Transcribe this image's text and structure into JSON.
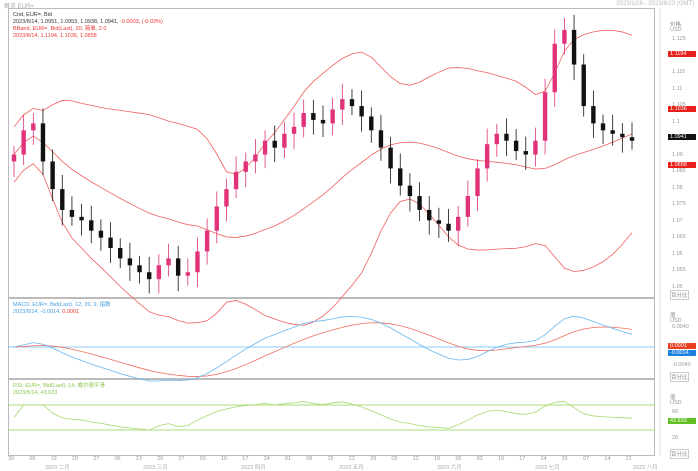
{
  "header": {
    "tab": "概览 EUR=",
    "range": "2023/1/26 - 2023/8/23 (GMT)"
  },
  "legend": {
    "candle_title": "Cnd, EUR=, Bid",
    "candle_values": "2023/8/14, 1.0951, 1.0953, 1.0938, 1.0941,",
    "candle_change": "-0.0003, (-0.03%)",
    "bb_title": "BBand, EUR=, Bid(Last), 20, 简单, 2.0",
    "bb_values": "2023/8/14, 1.1194, 1.1036, 1.0858",
    "macd_title": "MACD, EUR=, Bid(Last), 12, 26, 9, 指数",
    "macd_date": "2023/8/14, -0.0014,",
    "macd_signal": "0.0001",
    "rsi_title": "RSI, EUR=, Bid(Last), 14, 威尔德平滑",
    "rsi_values": "2023/8/14, 43.633"
  },
  "axis": {
    "price_header": "价格",
    "currency": "USD",
    "price_ticks": [
      "1.125",
      "1.12",
      "1.115",
      "1.11",
      "1.105",
      "1.1",
      "1.095",
      "1.09",
      "1.085",
      "1.08",
      "1.075",
      "1.07",
      "1.065",
      "1.06",
      "1.055",
      "1.05"
    ],
    "macd_header": "值",
    "macd_ticks": [
      "0.0040",
      "-0.0040"
    ],
    "rsi_header": "值",
    "rsi_ticks": [
      "60",
      "20"
    ],
    "scale_btn": "百分比",
    "labels": {
      "bb_upper": "1.1194",
      "bb_mid": "1.1036",
      "last": "1.0941",
      "bb_lower": "1.0858",
      "macd_signal": "0.0001",
      "macd": "-0.0014",
      "rsi": "43.633"
    },
    "day_ticks": [
      "30",
      "06",
      "13",
      "20",
      "27",
      "06",
      "13",
      "20",
      "27",
      "03",
      "10",
      "17",
      "24",
      "01",
      "08",
      "15",
      "22",
      "29",
      "05",
      "12",
      "19",
      "26",
      "03",
      "10",
      "17",
      "24",
      "31",
      "07",
      "14",
      "21"
    ],
    "months": [
      "2023 二月",
      "2023 三月",
      "2023 四月",
      "2023 五月",
      "2023 六月",
      "2023 七月",
      "2023 八月"
    ]
  },
  "colors": {
    "up": "#e0337a",
    "down": "#111111",
    "band": "#f06060",
    "macd": "#6ab8f0",
    "signal": "#f07060",
    "rsi": "#a8d870",
    "level": "#8fd050"
  },
  "chart_data": {
    "type": "candlestick",
    "ylim": [
      1.05,
      1.128
    ],
    "indicators": [
      "BBand 20 2.0",
      "MACD 12 26 9",
      "RSI 14"
    ],
    "rsi_levels": [
      70,
      30
    ],
    "closes": [
      1.09,
      1.097,
      1.099,
      1.088,
      1.08,
      1.074,
      1.072,
      1.071,
      1.068,
      1.066,
      1.063,
      1.06,
      1.058,
      1.056,
      1.054,
      1.058,
      1.06,
      1.055,
      1.056,
      1.062,
      1.068,
      1.075,
      1.08,
      1.085,
      1.088,
      1.09,
      1.094,
      1.092,
      1.096,
      1.098,
      1.102,
      1.1,
      1.099,
      1.103,
      1.106,
      1.104,
      1.101,
      1.097,
      1.092,
      1.086,
      1.081,
      1.078,
      1.074,
      1.071,
      1.07,
      1.068,
      1.072,
      1.078,
      1.086,
      1.093,
      1.096,
      1.094,
      1.091,
      1.09,
      1.094,
      1.108,
      1.122,
      1.126,
      1.116,
      1.104,
      1.099,
      1.097,
      1.096,
      1.095,
      1.094
    ]
  }
}
